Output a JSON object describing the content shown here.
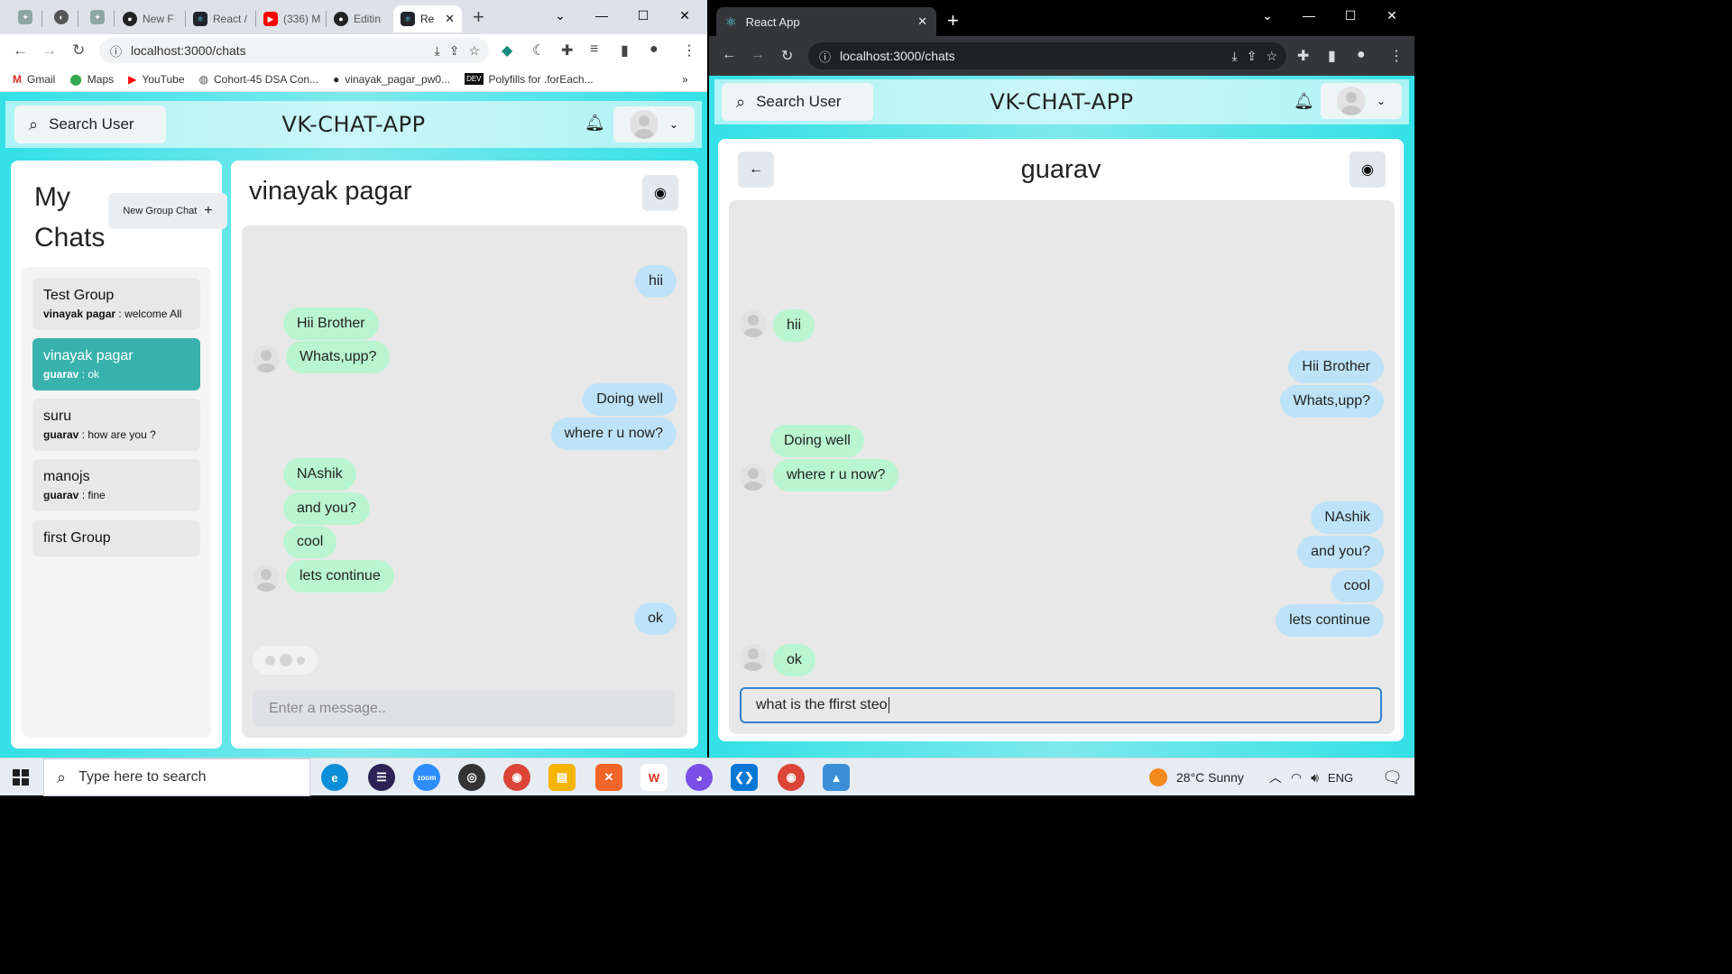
{
  "colors": {
    "accent": "#38b2ac",
    "mine_bubble": "#bee3f8",
    "their_bubble": "#b9f5d0",
    "header_bg": "#33e0e6"
  },
  "left_window": {
    "tabs": [
      "New F",
      "React /",
      "(336) M",
      "Editin",
      "Re"
    ],
    "url": "localhost:3000/chats",
    "bookmarks": [
      "Gmail",
      "Maps",
      "YouTube",
      "Cohort-45 DSA Con...",
      "vinayak_pagar_pw0...",
      "Polyfills for .forEach..."
    ],
    "bookmarks_more": "»",
    "app": {
      "search_label": "Search User",
      "title": "VK-CHAT-APP",
      "my_chats_title": "My Chats",
      "new_group_label": "New Group Chat",
      "chats": [
        {
          "name": "Test Group",
          "sender": "vinayak pagar",
          "message": "welcome All"
        },
        {
          "name": "vinayak pagar",
          "sender": "guarav",
          "message": "ok"
        },
        {
          "name": "suru",
          "sender": "guarav",
          "message": "how are you ?"
        },
        {
          "name": "manojs",
          "sender": "guarav",
          "message": "fine"
        },
        {
          "name": "first Group",
          "sender": "",
          "message": ""
        }
      ],
      "chat_title": "vinayak pagar",
      "messages": [
        "hii",
        "Hii Brother",
        "Whats,upp?",
        "Doing well",
        "where r u now?",
        "NAshik",
        "and you?",
        "cool",
        "lets continue",
        "ok"
      ],
      "input_placeholder": "Enter a message.."
    }
  },
  "right_window": {
    "tab_title": "React App",
    "url": "localhost:3000/chats",
    "app": {
      "search_label": "Search User",
      "title": "VK-CHAT-APP",
      "chat_title": "guarav",
      "messages": [
        "hii",
        "Hii Brother",
        "Whats,upp?",
        "Doing well",
        "where r u now?",
        "NAshik",
        "and you?",
        "cool",
        "lets continue",
        "ok"
      ],
      "input_value": "what is the ffirst steo"
    }
  },
  "taskbar": {
    "search_placeholder": "Type here to search",
    "weather": "28°C  Sunny",
    "language": "ENG"
  }
}
